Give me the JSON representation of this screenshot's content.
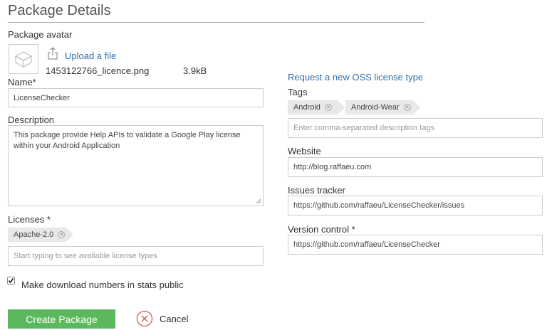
{
  "header": {
    "title": "Package Details"
  },
  "avatar": {
    "label": "Package avatar",
    "upload_label": "Upload a file",
    "file_name": "1453122766_licence.png",
    "file_size": "3.9kB"
  },
  "name": {
    "label": "Name*",
    "value": "LicenseChecker"
  },
  "description": {
    "label": "Description",
    "value": "This package provide Help APIs to validate a Google Play license within your Android Application"
  },
  "licenses": {
    "label": "Licenses *",
    "tags": [
      "Apache-2.0"
    ],
    "placeholder": "Start typing to see available license types"
  },
  "right": {
    "request_link": "Request a new OSS license type",
    "tags_label": "Tags",
    "tags": [
      "Android",
      "Android-Wear"
    ],
    "tags_placeholder": "Enter comma-separated description tags",
    "website_label": "Website",
    "website_value": "http://blog.raffaeu.com",
    "issues_label": "Issues tracker",
    "issues_value": "https://github.com/raffaeu/LicenseChecker/issues",
    "vcs_label": "Version control *",
    "vcs_value": "https://github.com/raffaeu/LicenseChecker"
  },
  "stats_checkbox": {
    "label": "Make download numbers in stats public",
    "checked": true
  },
  "actions": {
    "create_label": "Create Package",
    "cancel_label": "Cancel"
  },
  "colors": {
    "primary_button": "#5cb85c",
    "link": "#2f6fab",
    "cancel_icon": "#d9534f"
  },
  "icons": [
    "package-icon",
    "upload-icon",
    "remove-tag-icon",
    "check-icon",
    "cancel-icon",
    "resize-grip-icon"
  ]
}
